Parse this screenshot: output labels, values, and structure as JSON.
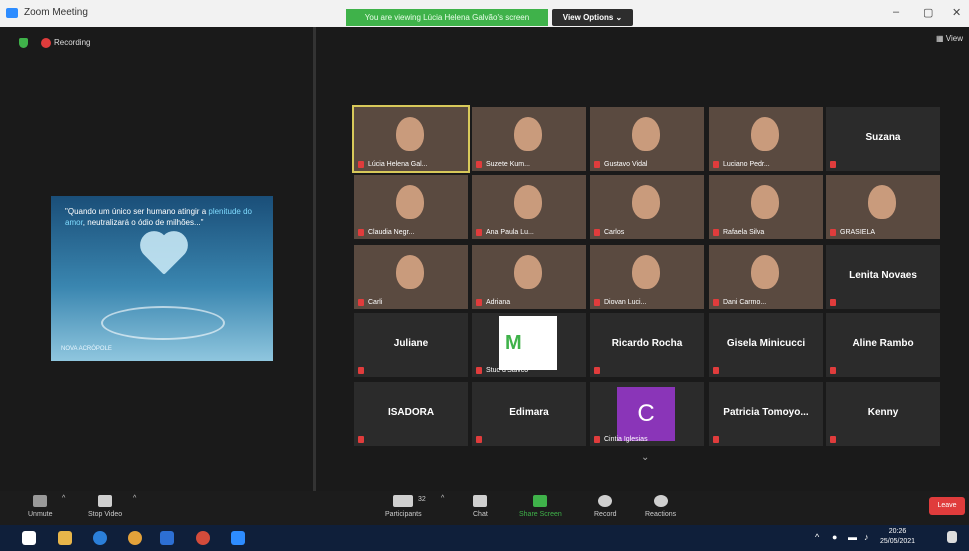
{
  "window": {
    "title": "Zoom Meeting",
    "banner": "You are viewing Lúcia Helena Galvão's screen",
    "view_options": "View Options",
    "minimize": "–",
    "maximize": "▢",
    "close": "✕"
  },
  "meeting": {
    "recording": "Recording",
    "view": "View"
  },
  "shared_slide": {
    "quote_start": "\"Quando um único ser humano atingir a ",
    "quote_highlight": "plenitude do amor",
    "quote_end": ", neutralizará o ódio de milhões...\"",
    "logo": "NOVA ACRÓPOLE"
  },
  "participants": [
    {
      "label": "Lúcia Helena Gal...",
      "kind": "video"
    },
    {
      "label": "Suzete Kum...",
      "kind": "video"
    },
    {
      "label": "Gustavo Vidal",
      "kind": "video"
    },
    {
      "label": "Luciano Pedr...",
      "kind": "video"
    },
    {
      "label": "Suzana",
      "kind": "named"
    },
    {
      "label": "Claudia Negr...",
      "kind": "video"
    },
    {
      "label": "Ana Paula Lu...",
      "kind": "video"
    },
    {
      "label": "Carlos",
      "kind": "video"
    },
    {
      "label": "Rafaela Silva",
      "kind": "video"
    },
    {
      "label": "GRASIELA",
      "kind": "video"
    },
    {
      "label": "Carli",
      "kind": "video"
    },
    {
      "label": "Adriana",
      "kind": "video"
    },
    {
      "label": "Diovan Luci...",
      "kind": "video"
    },
    {
      "label": "Dani Carmo...",
      "kind": "video"
    },
    {
      "label": "Lenita Novaes",
      "kind": "named"
    },
    {
      "label": "Juliane",
      "kind": "named"
    },
    {
      "label": "Stuc d'Salvco",
      "kind": "logo"
    },
    {
      "label": "Ricardo Rocha",
      "kind": "named"
    },
    {
      "label": "Gisela Minicucci",
      "kind": "named"
    },
    {
      "label": "Aline Rambo",
      "kind": "named"
    },
    {
      "label": "ISADORA",
      "kind": "named"
    },
    {
      "label": "Edimara",
      "kind": "named"
    },
    {
      "label": "Cintia Iglesias",
      "kind": "avatar",
      "initial": "C"
    },
    {
      "label": "Patricia Tomoyo...",
      "kind": "named"
    },
    {
      "label": "Kenny",
      "kind": "named"
    }
  ],
  "toolbar": {
    "unmute": "Unmute",
    "stop_video": "Stop Video",
    "participants": "Participants",
    "participants_count": "32",
    "chat": "Chat",
    "share_screen": "Share Screen",
    "record": "Record",
    "reactions": "Reactions",
    "leave": "Leave"
  },
  "taskbar": {
    "time": "20:26",
    "date": "25/05/2021"
  }
}
